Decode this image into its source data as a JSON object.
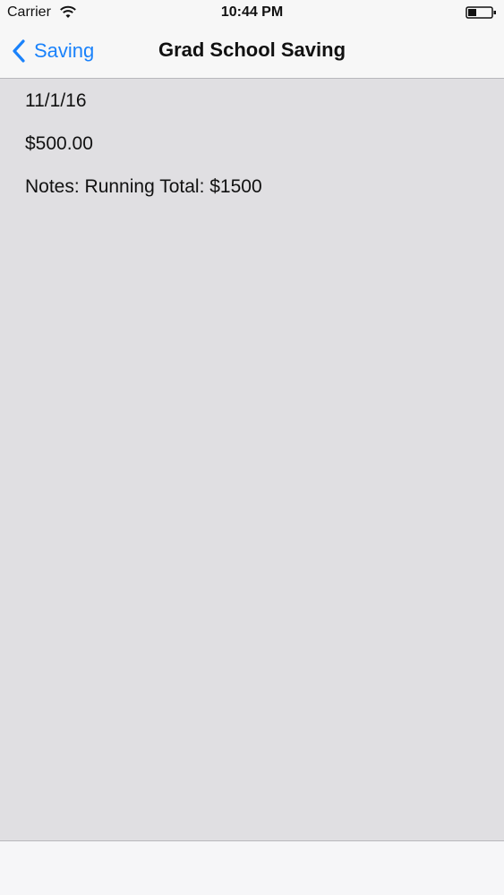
{
  "status_bar": {
    "carrier": "Carrier",
    "time": "10:44 PM",
    "icons": [
      "wifi-icon",
      "battery-icon"
    ]
  },
  "nav_bar": {
    "back_label": "Saving",
    "title": "Grad School Saving",
    "accent_color": "#1a82fb"
  },
  "detail": {
    "date": "11/1/16",
    "amount": "$500.00",
    "notes": "Notes: Running Total: $1500"
  },
  "colors": {
    "content_background": "#e0dfe2",
    "bar_background": "#f7f7f7"
  }
}
